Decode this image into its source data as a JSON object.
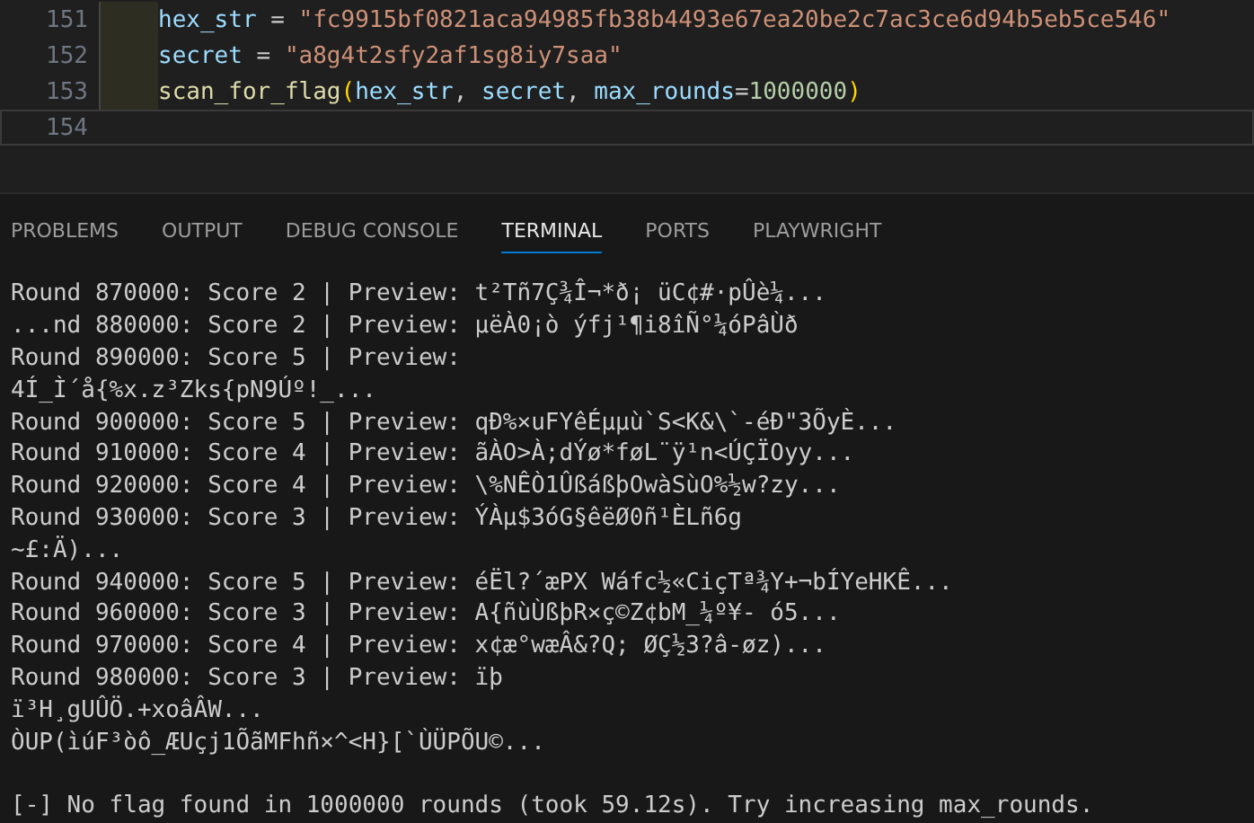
{
  "editor": {
    "lines": [
      {
        "number": "151",
        "current": false,
        "tokens": [
          {
            "kind": "var",
            "text": "hex_str"
          },
          {
            "kind": "plain",
            "text": " = "
          },
          {
            "kind": "string",
            "text": "\"fc9915bf0821aca94985fb38b4493e67ea20be2c7ac3ce6d94b5eb5ce546\""
          }
        ]
      },
      {
        "number": "152",
        "current": false,
        "tokens": [
          {
            "kind": "var",
            "text": "secret"
          },
          {
            "kind": "plain",
            "text": " = "
          },
          {
            "kind": "string",
            "text": "\"a8g4t2sfy2af1sg8iy7saa\""
          }
        ]
      },
      {
        "number": "153",
        "current": false,
        "tokens": [
          {
            "kind": "func",
            "text": "scan_for_flag"
          },
          {
            "kind": "paren",
            "text": "("
          },
          {
            "kind": "var",
            "text": "hex_str"
          },
          {
            "kind": "plain",
            "text": ", "
          },
          {
            "kind": "var",
            "text": "secret"
          },
          {
            "kind": "plain",
            "text": ", "
          },
          {
            "kind": "var",
            "text": "max_rounds"
          },
          {
            "kind": "plain",
            "text": "="
          },
          {
            "kind": "number",
            "text": "1000000"
          },
          {
            "kind": "paren",
            "text": ")"
          }
        ]
      },
      {
        "number": "154",
        "current": true
      }
    ]
  },
  "panel_tabs": [
    {
      "label": "PROBLEMS",
      "selected": false
    },
    {
      "label": "OUTPUT",
      "selected": false
    },
    {
      "label": "DEBUG CONSOLE",
      "selected": false
    },
    {
      "label": "TERMINAL",
      "selected": true
    },
    {
      "label": "PORTS",
      "selected": false
    },
    {
      "label": "PLAYWRIGHT",
      "selected": false
    }
  ],
  "terminal": {
    "lines": [
      "Round 870000: Score 2 | Preview: t²Tñ7Ç¾Î¬*ð¡ üC¢#·pÛè¼...",
      "...nd 880000: Score 2 | Preview: µëÀ0¡ò ýfj¹¶i8îÑ°¼óPâÙð",
      "Round 890000: Score 5 | Preview: ",
      "4Í_Ì´å{%x.z³Zks{pN9Úº!_...",
      "Round 900000: Score 5 | Preview: qÐ%×uFYêÉµµù`S<K&\\`-éÐ\"3ÕyÈ...",
      "Round 910000: Score 4 | Preview: ãÀO>À;dÝø*føL¨ÿ¹n<ÚÇÏOyy...",
      "Round 920000: Score 4 | Preview: \\%NÊÒ1ÛßáßþOwàSùO%½w?zy...",
      "Round 930000: Score 3 | Preview: ÝÀµ$3óG§êëØ0ñ¹ÈLñ6g",
      "~£:Ä)...",
      "Round 940000: Score 5 | Preview: éËl?´æPX Wáfc½«CiçTª¾Y+¬bÍYeHKÊ...",
      "Round 960000: Score 3 | Preview: A{ñùÙßþR×ç©Z¢bM_¼º¥- ó5...",
      "Round 970000: Score 4 | Preview: x¢æ°wæÂ&?Q; ØÇ½3?â-øz)...",
      "Round 980000: Score 3 | Preview: ïþ",
      "ï³H¸gUÛÖ.+xoâÂW...",
      "ÒUP(ìúF³òô_ÆUçj1ÕãMFhñ×^<H}[`ÙÜPÕU©..."
    ],
    "summary": "[-] No flag found in 1000000 rounds (took 59.12s). Try increasing max_rounds."
  }
}
